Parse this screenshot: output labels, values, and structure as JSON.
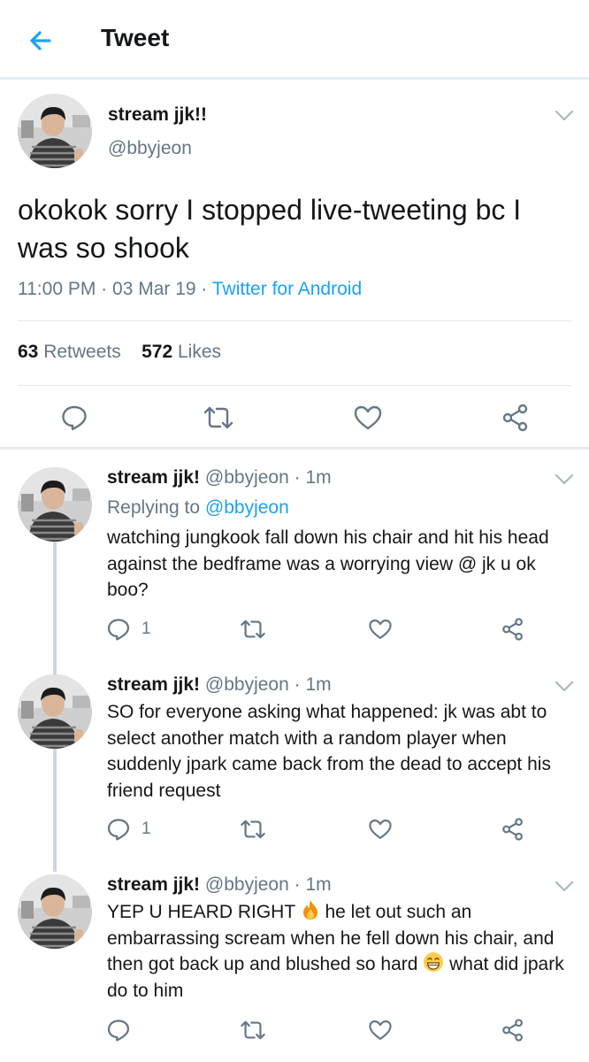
{
  "header": {
    "title": "Tweet",
    "back_icon": "arrow-left-icon"
  },
  "colors": {
    "accent": "#1da1f2",
    "secondary_text": "#657786",
    "text": "#14171a"
  },
  "main_tweet": {
    "name": "stream jjk!!",
    "handle": "@bbyjeon",
    "text": "okokok sorry I stopped live-tweeting bc I was so shook",
    "time": "11:00 PM",
    "date": "03 Mar 19",
    "source": "Twitter for Android",
    "retweets_count": "63",
    "retweets_label": "Retweets",
    "likes_count": "572",
    "likes_label": "Likes"
  },
  "replies": [
    {
      "name": "stream jjk!",
      "handle": "@bbyjeon",
      "time": "1m",
      "replying_label": "Replying to",
      "replying_to": "@bbyjeon",
      "text": "watching jungkook fall down his chair and hit his head against the bedframe was a worrying view @ jk u ok boo?",
      "reply_count": "1"
    },
    {
      "name": "stream jjk!",
      "handle": "@bbyjeon",
      "time": "1m",
      "text": "SO for everyone asking what happened: jk was abt to select another match with a random player when suddenly jpark came back from the dead to accept his friend request",
      "reply_count": "1"
    },
    {
      "name": "stream jjk!",
      "handle": "@bbyjeon",
      "time": "1m",
      "text_a": "YEP U HEARD RIGHT",
      "emoji_a": "fire-emoji",
      "text_b": "he let out such an embarrassing scream when he fell down his chair, and then got back up and blushed so hard",
      "emoji_b": "grinning-face-emoji",
      "text_c": "what did jpark do to him"
    }
  ],
  "sep": "·"
}
